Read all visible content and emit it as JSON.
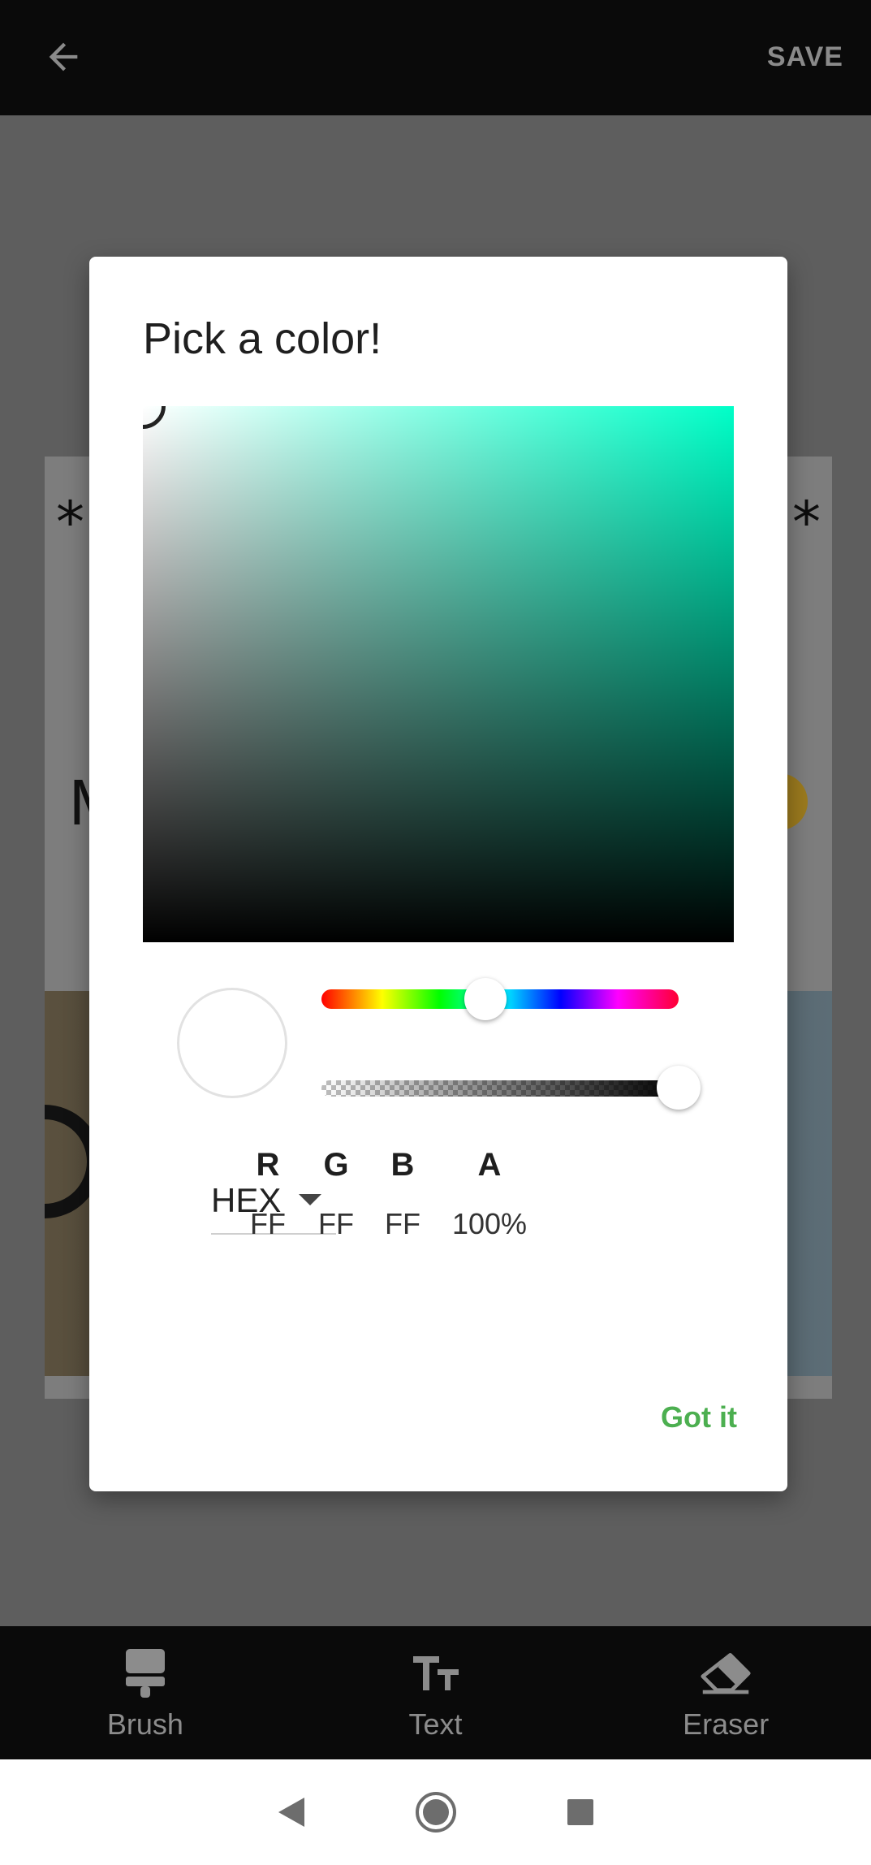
{
  "appbar": {
    "save_label": "SAVE"
  },
  "canvas": {
    "star_left": "*",
    "star_right": "*",
    "letter": "M"
  },
  "dialog": {
    "title": "Pick a color!",
    "hue_color": "#00ffc8",
    "preview_color": "#ffffff",
    "mode": "HEX",
    "channels": [
      {
        "name": "R",
        "value": "FF"
      },
      {
        "name": "G",
        "value": "FF"
      },
      {
        "name": "B",
        "value": "FF"
      },
      {
        "name": "A",
        "value": "100%"
      }
    ],
    "hue_position": 0.46,
    "alpha_position": 1.0,
    "confirm_label": "Got it",
    "confirm_color": "#4caf50"
  },
  "toolbar": {
    "items": [
      {
        "label": "Brush",
        "icon": "brush-icon"
      },
      {
        "label": "Text",
        "icon": "text-icon"
      },
      {
        "label": "Eraser",
        "icon": "eraser-icon"
      }
    ]
  },
  "sysnav": {
    "back": "back-triangle-icon",
    "home": "home-circle-icon",
    "recents": "recents-square-icon"
  }
}
